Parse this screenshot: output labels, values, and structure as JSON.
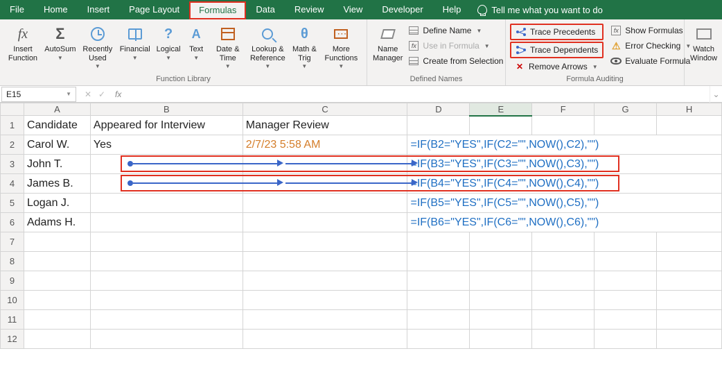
{
  "tabs": [
    "File",
    "Home",
    "Insert",
    "Page Layout",
    "Formulas",
    "Data",
    "Review",
    "View",
    "Developer",
    "Help"
  ],
  "active_tab": "Formulas",
  "tell_me": "Tell me what you want to do",
  "ribbon": {
    "insert_function": "Insert\nFunction",
    "autosum": "AutoSum",
    "recently": "Recently\nUsed",
    "financial": "Financial",
    "logical": "Logical",
    "text": "Text",
    "datetime": "Date &\nTime",
    "lookup": "Lookup &\nReference",
    "math": "Math &\nTrig",
    "more": "More\nFunctions",
    "group_library": "Function Library",
    "name_mgr": "Name\nManager",
    "define_name": "Define Name",
    "use_in_formula": "Use in Formula",
    "create_sel": "Create from Selection",
    "group_names": "Defined Names",
    "trace_prec": "Trace Precedents",
    "trace_dep": "Trace Dependents",
    "remove_arrows": "Remove Arrows",
    "show_formulas": "Show Formulas",
    "error_check": "Error Checking",
    "eval_formula": "Evaluate Formula",
    "group_audit": "Formula Auditing",
    "watch": "Watch\nWindow"
  },
  "namebox": "E15",
  "formula_input": "",
  "columns": [
    "A",
    "B",
    "C",
    "D",
    "E",
    "F",
    "G",
    "H"
  ],
  "row_numbers": [
    "1",
    "2",
    "3",
    "4",
    "5",
    "6",
    "7",
    "8",
    "9",
    "10",
    "11",
    "12"
  ],
  "headers": {
    "A": "Candidate",
    "B": "Appeared for Interview",
    "C": "Manager Review"
  },
  "data": [
    {
      "A": "Carol W.",
      "B": "Yes",
      "C": "2/7/23 5:58 AM",
      "D": "=IF(B2=\"YES\",IF(C2=\"\",NOW(),C2),\"\")"
    },
    {
      "A": "John T.",
      "B": "",
      "C": "",
      "D": "=IF(B3=\"YES\",IF(C3=\"\",NOW(),C3),\"\")"
    },
    {
      "A": "James B.",
      "B": "",
      "C": "",
      "D": "=IF(B4=\"YES\",IF(C4=\"\",NOW(),C4),\"\")"
    },
    {
      "A": "Logan J.",
      "B": "",
      "C": "",
      "D": "=IF(B5=\"YES\",IF(C5=\"\",NOW(),C5),\"\")"
    },
    {
      "A": "Adams H.",
      "B": "",
      "C": "",
      "D": "=IF(B6=\"YES\",IF(C6=\"\",NOW(),C6),\"\")"
    }
  ]
}
